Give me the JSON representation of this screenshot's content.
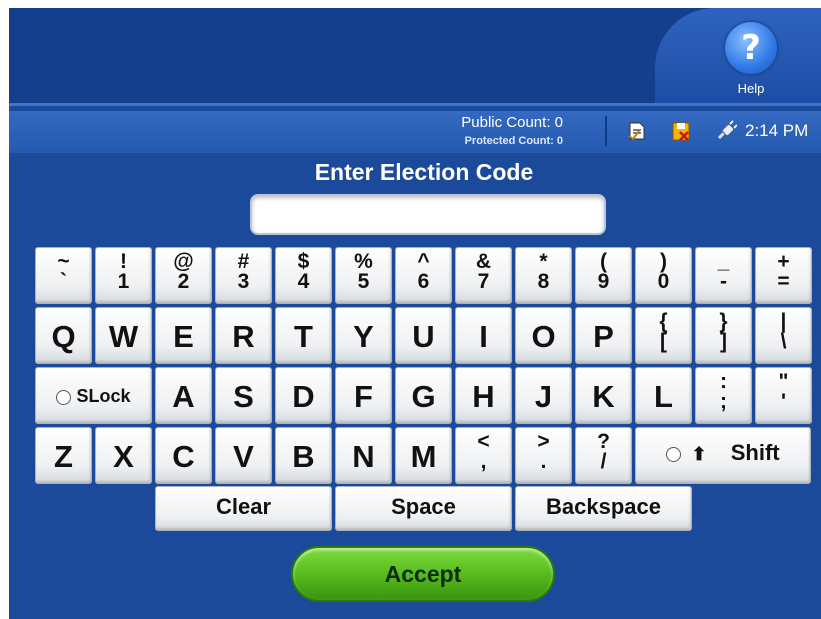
{
  "help": {
    "label": "Help",
    "icon": "help-icon"
  },
  "status": {
    "public_count": "Public Count: 0",
    "protected_count": "Protected Count: 0",
    "time": "2:14 PM",
    "icons": [
      "document-icon",
      "memory-card-icon",
      "power-plug-icon"
    ]
  },
  "title": "Enter Election Code",
  "input": {
    "value": ""
  },
  "keyboard": {
    "row1": [
      {
        "top": "~",
        "bottom": "`"
      },
      {
        "top": "!",
        "bottom": "1"
      },
      {
        "top": "@",
        "bottom": "2"
      },
      {
        "top": "#",
        "bottom": "3"
      },
      {
        "top": "$",
        "bottom": "4"
      },
      {
        "top": "%",
        "bottom": "5"
      },
      {
        "top": "^",
        "bottom": "6"
      },
      {
        "top": "&",
        "bottom": "7"
      },
      {
        "top": "*",
        "bottom": "8"
      },
      {
        "top": "(",
        "bottom": "9"
      },
      {
        "top": ")",
        "bottom": "0"
      },
      {
        "top": "_",
        "bottom": "-"
      },
      {
        "top": "+",
        "bottom": "="
      }
    ],
    "row2": [
      "Q",
      "W",
      "E",
      "R",
      "T",
      "Y",
      "U",
      "I",
      "O",
      "P"
    ],
    "row2_sym": [
      {
        "top": "{",
        "bottom": "["
      },
      {
        "top": "}",
        "bottom": "]"
      },
      {
        "top": "|",
        "bottom": "\\"
      }
    ],
    "slock": "SLock",
    "row3": [
      "A",
      "S",
      "D",
      "F",
      "G",
      "H",
      "J",
      "K",
      "L"
    ],
    "row3_sym": [
      {
        "top": ":",
        "bottom": ";"
      },
      {
        "top": "\"",
        "bottom": "'"
      }
    ],
    "row4": [
      "Z",
      "X",
      "C",
      "V",
      "B",
      "N",
      "M"
    ],
    "row4_sym": [
      {
        "top": "<",
        "bottom": ","
      },
      {
        "top": ">",
        "bottom": "."
      },
      {
        "top": "?",
        "bottom": "/"
      }
    ],
    "shift": "Shift",
    "clear": "Clear",
    "space": "Space",
    "backspace": "Backspace"
  },
  "accept": "Accept",
  "colors": {
    "background": "#1b4a9b",
    "accept": "#53b81c",
    "key": "#f2f2f2"
  }
}
